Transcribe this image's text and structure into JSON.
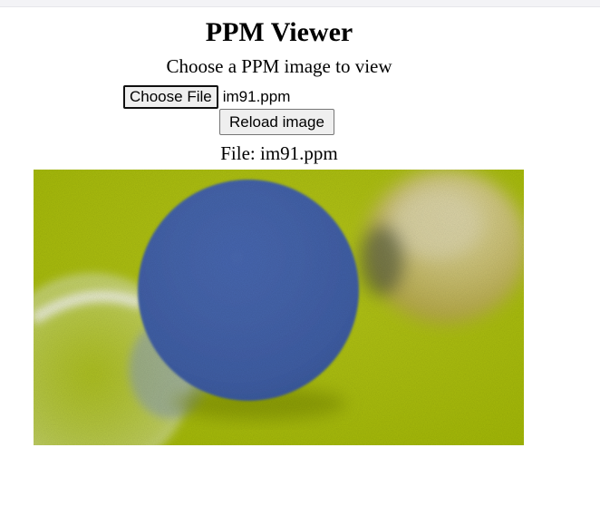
{
  "app": {
    "title": "PPM Viewer",
    "subtitle": "Choose a PPM image to view"
  },
  "file_input": {
    "button_label": "Choose File",
    "selected_file": "im91.ppm"
  },
  "reload_button": {
    "label": "Reload image"
  },
  "file_info": {
    "label": "File: im91.ppm"
  },
  "image": {
    "description_colors": {
      "background": "#b2c50a",
      "blue_sphere": "#4466b0",
      "gold_sphere": "#c8be5a",
      "glass_sphere": "#e6ecf0"
    }
  }
}
